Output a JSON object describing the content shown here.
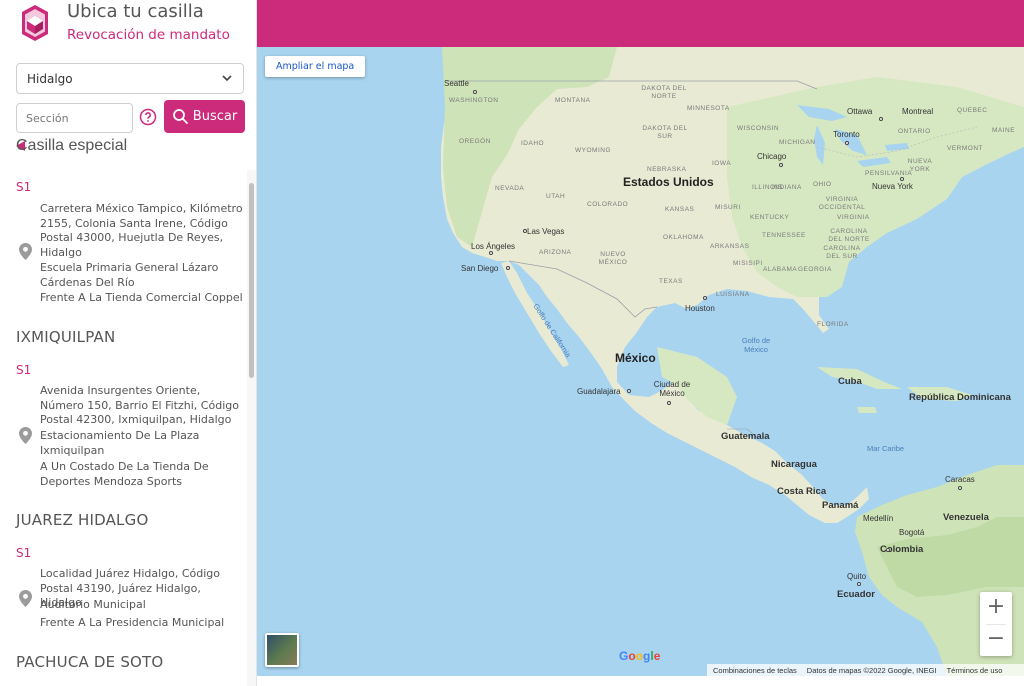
{
  "brand": {
    "title": "Ubica tu casilla",
    "subtitle": "Revocación de mandato",
    "accent_color": "#cc2b7b"
  },
  "filters": {
    "state_value": "Hidalgo",
    "section_placeholder": "Sección",
    "search_label": "Buscar",
    "special_label": "Casilla especial"
  },
  "municipalities": [
    {
      "name": "",
      "casillas": [
        {
          "id": "S1",
          "address": "Carretera México Tampico, Kilómetro 2155, Colonia Santa Irene, Código Postal 43000, Huejutla De Reyes, Hidalgo",
          "location": "Escuela Primaria General Lázaro Cárdenas Del Río",
          "reference": "Frente A La Tienda Comercial Coppel"
        }
      ]
    },
    {
      "name": "IXMIQUILPAN",
      "casillas": [
        {
          "id": "S1",
          "address": "Avenida Insurgentes Oriente, Número 150, Barrio El Fitzhi, Código Postal 42300, Ixmiquilpan, Hidalgo",
          "location": "Estacionamiento De La Plaza Ixmiquilpan",
          "reference": "A Un Costado De La Tienda De Deportes Mendoza Sports"
        }
      ]
    },
    {
      "name": "JUAREZ HIDALGO",
      "casillas": [
        {
          "id": "S1",
          "address": "Localidad Juárez Hidalgo, Código Postal 43190, Juárez Hidalgo, Hidalgo",
          "location": "Auditorio Municipal",
          "reference": "Frente A La Presidencia Municipal"
        }
      ]
    },
    {
      "name": "PACHUCA DE SOTO",
      "casillas": []
    }
  ],
  "map": {
    "enlarge_label": "Ampliar el mapa",
    "zoom_in": "+",
    "zoom_out": "−",
    "google": "Google",
    "attribution": [
      "Combinaciones de teclas",
      "Datos de mapas ©2022 Google, INEGI",
      "Términos de uso"
    ],
    "labels": {
      "countries": [
        "Estados Unidos",
        "México",
        "Cuba",
        "República Dominicana",
        "Guatemala",
        "Nicaragua",
        "Costa Rica",
        "Panamá",
        "Venezuela",
        "Colombia",
        "Ecuador"
      ],
      "cities": [
        "Seattle",
        "Ottawa",
        "Montreal",
        "Toronto",
        "Chicago",
        "Nueva York",
        "Las Vegas",
        "Los Ángeles",
        "San Diego",
        "Houston",
        "Guadalajara",
        "Ciudad de México",
        "Caracas",
        "Medellín",
        "Bogotá",
        "Quito"
      ],
      "states": [
        "WASHINGTON",
        "MONTANA",
        "DAKOTA DEL NORTE",
        "MINNESOTA",
        "OREGÓN",
        "IDAHO",
        "WYOMING",
        "DAKOTA DEL SUR",
        "WISCONSIN",
        "MICHIGAN",
        "NEBRASKA",
        "IOWA",
        "NEVADA",
        "UTAH",
        "COLORADO",
        "KANSAS",
        "MISURI",
        "ILLINOIS",
        "INDIANA",
        "OHIO",
        "PENSILVANIA",
        "NUEVA YORK",
        "VIRGINIA OCCIDENTAL",
        "VIRGINIA",
        "CAROLINA DEL NORTE",
        "CAROLINA DEL SUR",
        "KENTUCKY",
        "TENNESSEE",
        "ARIZONA",
        "NUEVO MÉXICO",
        "OKLAHOMA",
        "ARKANSAS",
        "MISISIPI",
        "ALABAMA",
        "GEORGIA",
        "TEXAS",
        "LUISIANA",
        "FLORIDA",
        "ONTARIO",
        "QUEBEC",
        "VERMONT",
        "MAINE"
      ],
      "seas": [
        "Golfo de California",
        "Golfo de México",
        "Mar Caribe"
      ]
    }
  }
}
